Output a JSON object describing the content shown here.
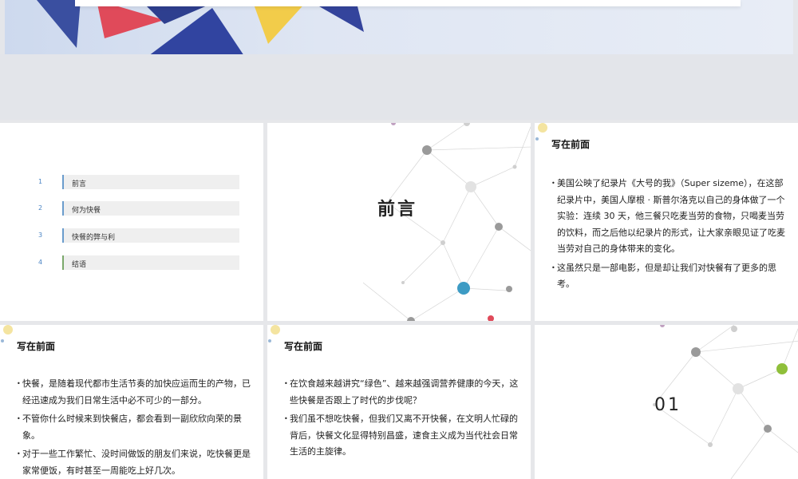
{
  "toc": {
    "items": [
      {
        "num": "1",
        "label": "前言"
      },
      {
        "num": "2",
        "label": "何为快餐"
      },
      {
        "num": "3",
        "label": "快餐的弊与利"
      },
      {
        "num": "4",
        "label": "结语"
      }
    ]
  },
  "slide2": {
    "title": "前言"
  },
  "slide3": {
    "heading": "写在前面",
    "bullets": [
      "美国公映了纪录片《大号的我》（Super sizeme），在这部纪录片中，美国人摩根 · 斯普尔洛克以自己的身体做了一个实验：连续 30 天，他三餐只吃麦当劳的食物，只喝麦当劳的饮料，而之后他以纪录片的形式，让大家亲眼见证了吃麦当劳对自己的身体带来的变化。",
      "这虽然只是一部电影，但是却让我们对快餐有了更多的思考。"
    ]
  },
  "slide4": {
    "heading": "写在前面",
    "bullets": [
      "快餐，是随着现代都市生活节奏的加快应运而生的产物，已经迅速成为我们日常生活中必不可少的一部分。",
      "不管你什么时候来到快餐店，都会看到一副欣欣向荣的景象。",
      "对于一些工作繁忙、没时间做饭的朋友们来说，吃快餐更是家常便饭，有时甚至一周能吃上好几次。"
    ]
  },
  "slide5": {
    "heading": "写在前面",
    "bullets": [
      "在饮食越来越讲究“绿色”、越来越强调营养健康的今天，这些快餐是否跟上了时代的步伐呢？",
      "我们虽不想吃快餐，但我们又离不开快餐，在文明人忙碌的背后，快餐文化显得特别昌盛，速食主义成为当代社会日常生活的主旋律。"
    ]
  },
  "slide6": {
    "title": "01"
  },
  "colors": {
    "accent_blue": "#3d9bc4",
    "accent_green": "#8fbf3a",
    "toc_bar": "#efefef"
  }
}
